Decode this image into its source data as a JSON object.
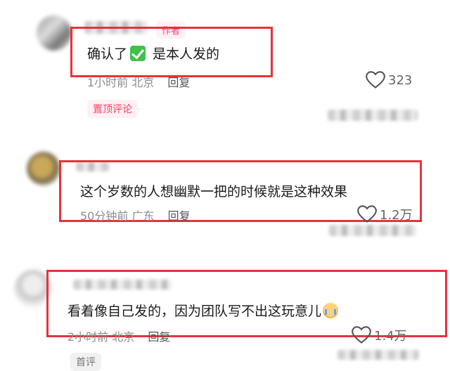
{
  "comments": [
    {
      "author_name": "大广青年",
      "author_tag": "作者",
      "text_before": "确认了",
      "check_icon": "check-mark-icon",
      "text_after": " 是本人发的",
      "time": "1小时前",
      "location": "北京",
      "reply_label": "回复",
      "likes": "323",
      "pin_tag": "置顶评论"
    },
    {
      "author_name": "",
      "text": "这个岁数的人想幽默一把的时候就是这种效果",
      "time": "50分钟前",
      "location": "广东",
      "reply_label": "回复",
      "likes": "1.2万"
    },
    {
      "author_name": "",
      "text": "看着像自己发的，因为团队写不出这玩意儿",
      "emoji": "crying-face-icon",
      "time": "2小时前",
      "location": "北京",
      "reply_label": "回复",
      "likes": "1.4万",
      "pin_tag": "首评"
    }
  ],
  "colors": {
    "highlight_box": "#e8323a",
    "tag_pink": "#ff3b63",
    "meta_gray": "#8c8c8c"
  }
}
